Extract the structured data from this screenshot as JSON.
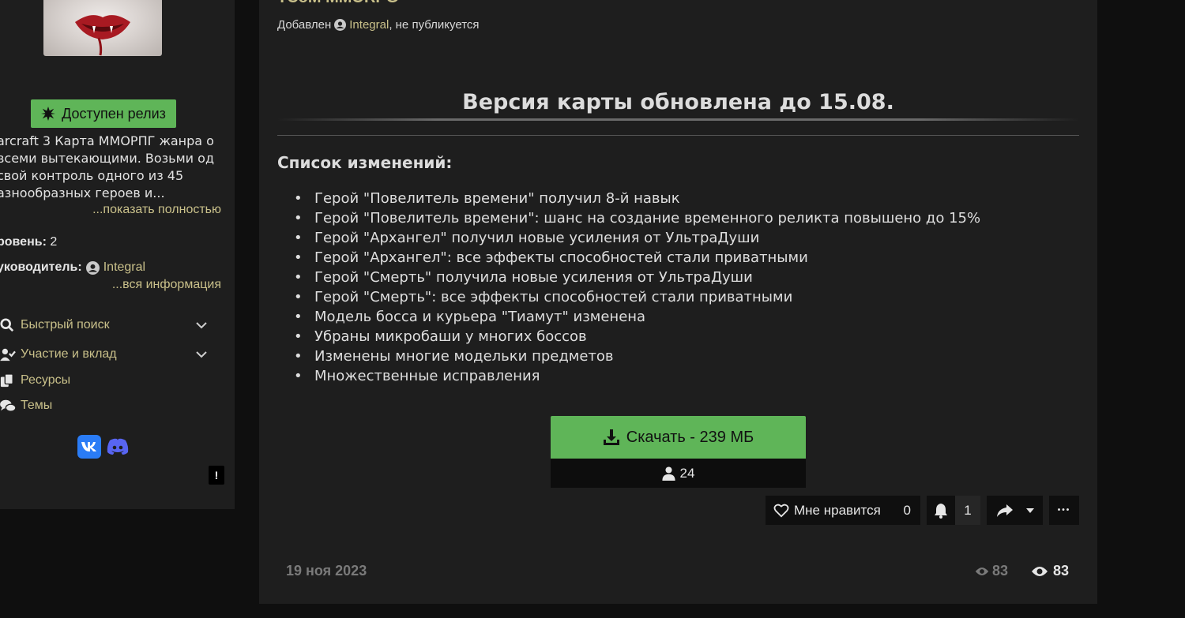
{
  "sidebar": {
    "release_badge": "Доступен релиз",
    "description": "arcraft 3 Карта ММОРПГ жанра о всеми вытекающими. Возьми од свой контроль одного из 45 азнообразных героев и...",
    "show_more": "...показать полностью",
    "level_label": "ровень:",
    "level_value": "2",
    "leader_label": "уководитель:",
    "leader_value": "Integral",
    "all_info": "...вся информация",
    "nav": [
      {
        "label": "Быстрый поиск",
        "icon": "search-icon",
        "expandable": true
      },
      {
        "label": "Участие и вклад",
        "icon": "user-check-icon",
        "expandable": true
      },
      {
        "label": "Ресурсы",
        "icon": "copy-icon",
        "expandable": false
      },
      {
        "label": "Темы",
        "icon": "comments-icon",
        "expandable": false
      }
    ],
    "socials": [
      "vk-icon",
      "discord-icon"
    ],
    "report_label": "!"
  },
  "post": {
    "title": "TCoM MMORPG",
    "meta_prefix": "Добавлен",
    "meta_author": "Integral",
    "meta_suffix": ", не публикуется",
    "heading": "Версия карты обновлена до 15.08.",
    "changes_title": "Список изменений:",
    "changes": [
      "Герой \"Повелитель времени\" получил 8-й навык",
      "Герой \"Повелитель времени\": шанс на создание временного реликта повышено до 15%",
      "Герой \"Архангел\" получил новые усиления от УльтраДуши",
      "Герой \"Архангел\": все эффекты способностей стали приватными",
      "Герой \"Смерть\" получила новые усиления от УльтраДуши",
      "Герой \"Смерть\": все эффекты способностей стали приватными",
      "Модель босса и курьера \"Тиамут\" изменена",
      "Убраны микробаши у многих боссов",
      "Изменены многие модельки предметов",
      "Множественные исправления"
    ],
    "download_label": "Скачать - 239 МБ",
    "download_count": "24",
    "like_label": "Мне нравится",
    "like_count": "0",
    "bell_count": "1",
    "more_label": "•••",
    "date": "19 ноя 2023",
    "views_small": "83",
    "views_big": "83"
  },
  "colors": {
    "accent_green": "#5fb558",
    "gold_link": "#c9c08a",
    "panel_bg": "#1e1e1e",
    "page_bg": "#0f0f0f"
  }
}
